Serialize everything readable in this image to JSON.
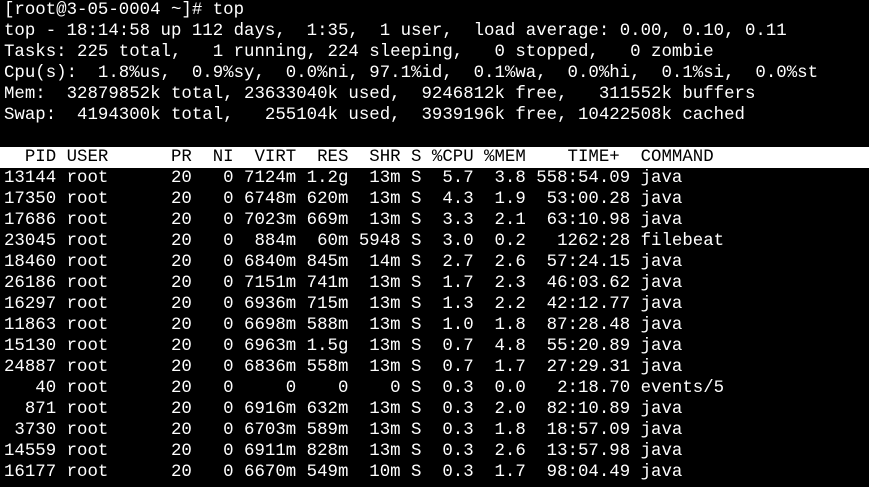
{
  "colors": {
    "background": "#000000",
    "foreground": "#ffffff",
    "header_background": "#ffffff",
    "header_foreground": "#000000"
  },
  "terminal": {
    "prompt_line": "[root@3-05-0004 ~]# top",
    "summary": {
      "uptime_line": "top - 18:14:58 up 112 days,  1:35,  1 user,  load average: 0.00, 0.10, 0.11",
      "tasks_line": "Tasks: 225 total,   1 running, 224 sleeping,   0 stopped,   0 zombie",
      "cpu_line": "Cpu(s):  1.8%us,  0.9%sy,  0.0%ni, 97.1%id,  0.1%wa,  0.0%hi,  0.1%si,  0.0%st",
      "mem_line": "Mem:  32879852k total, 23633040k used,  9246812k free,   311552k buffers",
      "swap_line": "Swap:  4194300k total,   255104k used,  3939196k free, 10422508k cached"
    },
    "process_table": {
      "columns": [
        "PID",
        "USER",
        "PR",
        "NI",
        "VIRT",
        "RES",
        "SHR",
        "S",
        "%CPU",
        "%MEM",
        "TIME+",
        "COMMAND"
      ],
      "header_line": "  PID USER      PR  NI  VIRT  RES  SHR S %CPU %MEM    TIME+  COMMAND",
      "rows": [
        {
          "pid": "13144",
          "user": "root",
          "pr": "20",
          "ni": "0",
          "virt": "7124m",
          "res": "1.2g",
          "shr": "13m",
          "s": "S",
          "cpu": "5.7",
          "mem": "3.8",
          "time": "558:54.09",
          "command": "java"
        },
        {
          "pid": "17350",
          "user": "root",
          "pr": "20",
          "ni": "0",
          "virt": "6748m",
          "res": "620m",
          "shr": "13m",
          "s": "S",
          "cpu": "4.3",
          "mem": "1.9",
          "time": "53:00.28",
          "command": "java"
        },
        {
          "pid": "17686",
          "user": "root",
          "pr": "20",
          "ni": "0",
          "virt": "7023m",
          "res": "669m",
          "shr": "13m",
          "s": "S",
          "cpu": "3.3",
          "mem": "2.1",
          "time": "63:10.98",
          "command": "java"
        },
        {
          "pid": "23045",
          "user": "root",
          "pr": "20",
          "ni": "0",
          "virt": "884m",
          "res": "60m",
          "shr": "5948",
          "s": "S",
          "cpu": "3.0",
          "mem": "0.2",
          "time": "1262:28",
          "command": "filebeat"
        },
        {
          "pid": "18460",
          "user": "root",
          "pr": "20",
          "ni": "0",
          "virt": "6840m",
          "res": "845m",
          "shr": "14m",
          "s": "S",
          "cpu": "2.7",
          "mem": "2.6",
          "time": "57:24.15",
          "command": "java"
        },
        {
          "pid": "26186",
          "user": "root",
          "pr": "20",
          "ni": "0",
          "virt": "7151m",
          "res": "741m",
          "shr": "13m",
          "s": "S",
          "cpu": "1.7",
          "mem": "2.3",
          "time": "46:03.62",
          "command": "java"
        },
        {
          "pid": "16297",
          "user": "root",
          "pr": "20",
          "ni": "0",
          "virt": "6936m",
          "res": "715m",
          "shr": "13m",
          "s": "S",
          "cpu": "1.3",
          "mem": "2.2",
          "time": "42:12.77",
          "command": "java"
        },
        {
          "pid": "11863",
          "user": "root",
          "pr": "20",
          "ni": "0",
          "virt": "6698m",
          "res": "588m",
          "shr": "13m",
          "s": "S",
          "cpu": "1.0",
          "mem": "1.8",
          "time": "87:28.48",
          "command": "java"
        },
        {
          "pid": "15130",
          "user": "root",
          "pr": "20",
          "ni": "0",
          "virt": "6963m",
          "res": "1.5g",
          "shr": "13m",
          "s": "S",
          "cpu": "0.7",
          "mem": "4.8",
          "time": "55:20.89",
          "command": "java"
        },
        {
          "pid": "24887",
          "user": "root",
          "pr": "20",
          "ni": "0",
          "virt": "6836m",
          "res": "558m",
          "shr": "13m",
          "s": "S",
          "cpu": "0.7",
          "mem": "1.7",
          "time": "27:29.31",
          "command": "java"
        },
        {
          "pid": "40",
          "user": "root",
          "pr": "20",
          "ni": "0",
          "virt": "0",
          "res": "0",
          "shr": "0",
          "s": "S",
          "cpu": "0.3",
          "mem": "0.0",
          "time": "2:18.70",
          "command": "events/5"
        },
        {
          "pid": "871",
          "user": "root",
          "pr": "20",
          "ni": "0",
          "virt": "6916m",
          "res": "632m",
          "shr": "13m",
          "s": "S",
          "cpu": "0.3",
          "mem": "2.0",
          "time": "82:10.89",
          "command": "java"
        },
        {
          "pid": "3730",
          "user": "root",
          "pr": "20",
          "ni": "0",
          "virt": "6703m",
          "res": "589m",
          "shr": "13m",
          "s": "S",
          "cpu": "0.3",
          "mem": "1.8",
          "time": "18:57.09",
          "command": "java"
        },
        {
          "pid": "14559",
          "user": "root",
          "pr": "20",
          "ni": "0",
          "virt": "6911m",
          "res": "828m",
          "shr": "13m",
          "s": "S",
          "cpu": "0.3",
          "mem": "2.6",
          "time": "13:57.98",
          "command": "java"
        },
        {
          "pid": "16177",
          "user": "root",
          "pr": "20",
          "ni": "0",
          "virt": "6670m",
          "res": "549m",
          "shr": "10m",
          "s": "S",
          "cpu": "0.3",
          "mem": "1.7",
          "time": "98:04.49",
          "command": "java"
        }
      ]
    }
  }
}
